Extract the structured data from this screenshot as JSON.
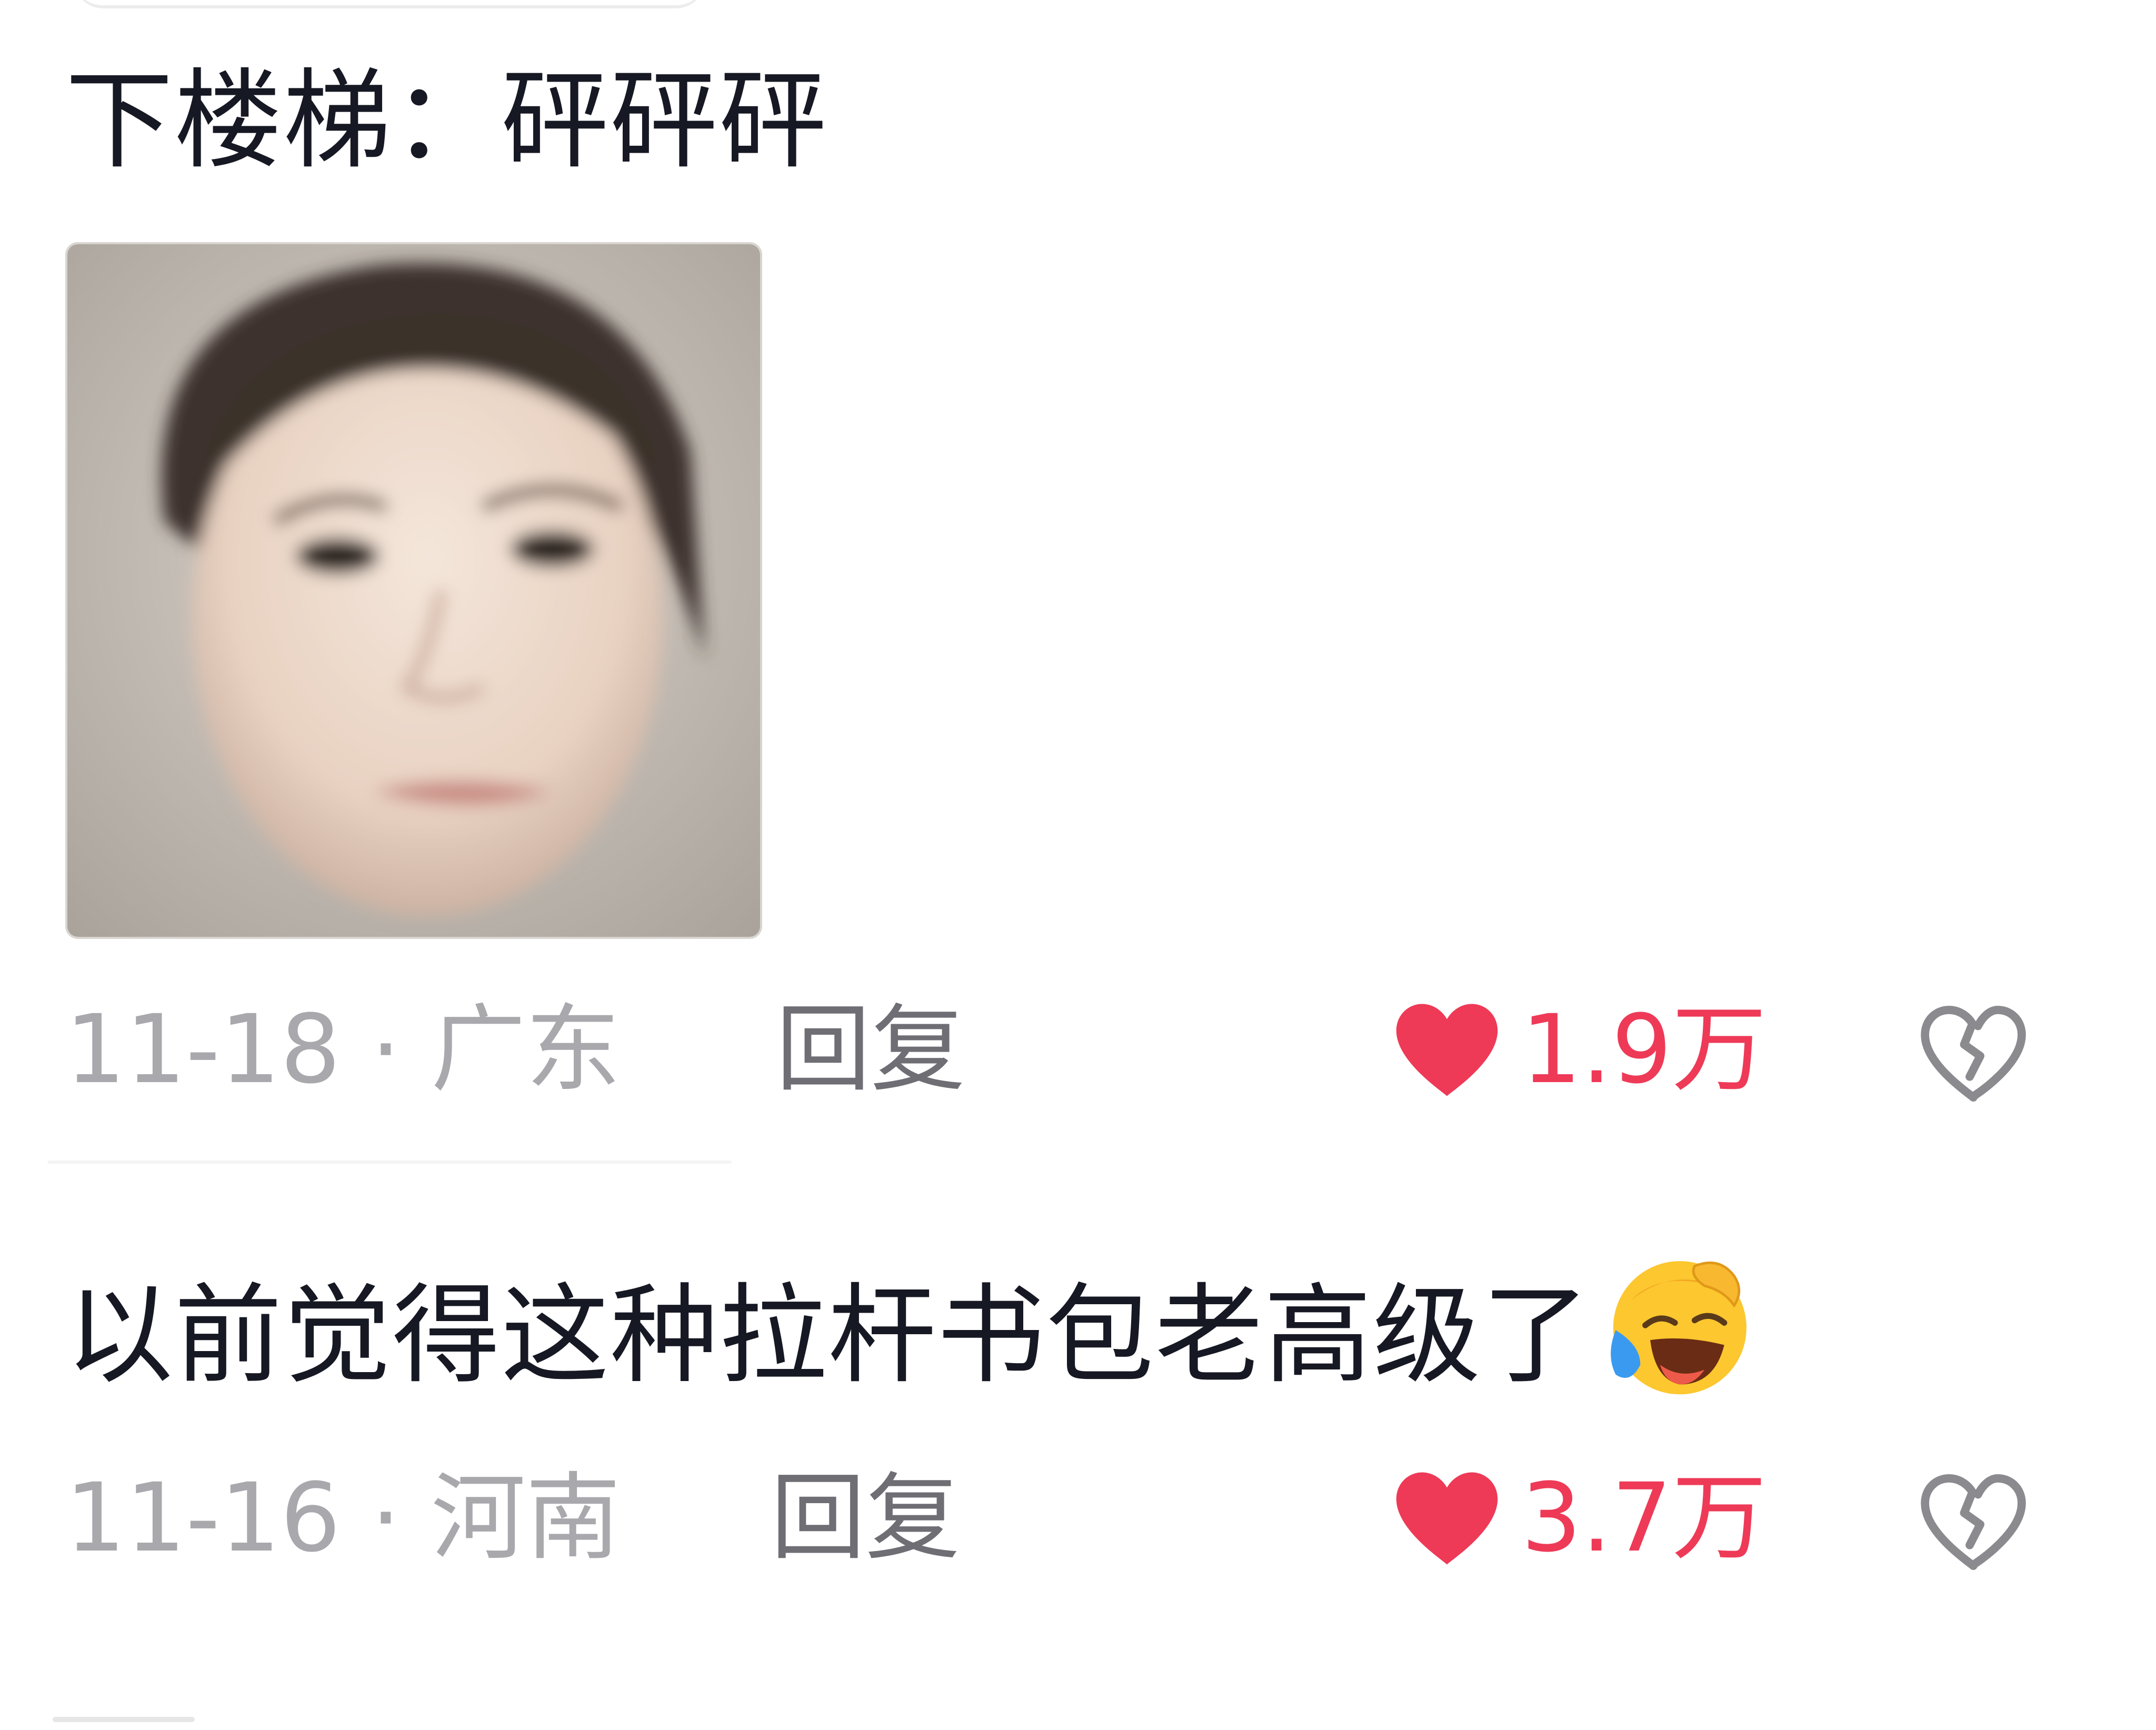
{
  "comments": [
    {
      "text": "下楼梯：砰砰砰",
      "has_image": true,
      "date": "11-18",
      "separator": "·",
      "location": "广东",
      "reply_label": "回复",
      "likes": "1.9万"
    },
    {
      "text": "以前觉得这种拉杆书包老高级了",
      "emoji": "crying-laughing-face-emoji",
      "date": "11-16",
      "separator": "·",
      "location": "河南",
      "reply_label": "回复",
      "likes": "3.7万"
    }
  ],
  "icons": {
    "like": "heart-icon",
    "dislike": "broken-heart-icon"
  },
  "colors": {
    "text": "#161823",
    "meta": "#a8a8ad",
    "reply": "#6e6e74",
    "like": "#ee3a57",
    "dislike": "#8a8a8f"
  }
}
